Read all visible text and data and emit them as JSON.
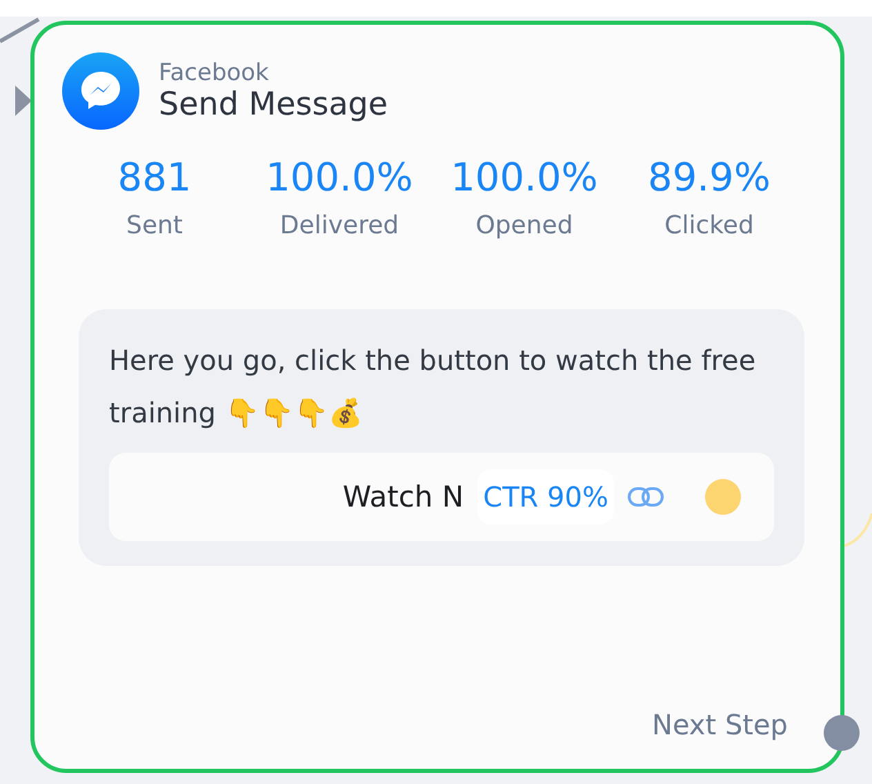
{
  "node": {
    "platform": "Facebook",
    "title": "Send Message"
  },
  "stats": [
    {
      "value": "881",
      "label": "Sent"
    },
    {
      "value": "100.0%",
      "label": "Delivered"
    },
    {
      "value": "100.0%",
      "label": "Opened"
    },
    {
      "value": "89.9%",
      "label": "Clicked"
    }
  ],
  "message": {
    "text": "Here you go, click the button to watch the free training 👇👇👇💰",
    "button": {
      "label": "Watch N",
      "ctr": "CTR 90%"
    }
  },
  "next_step": "Next Step"
}
